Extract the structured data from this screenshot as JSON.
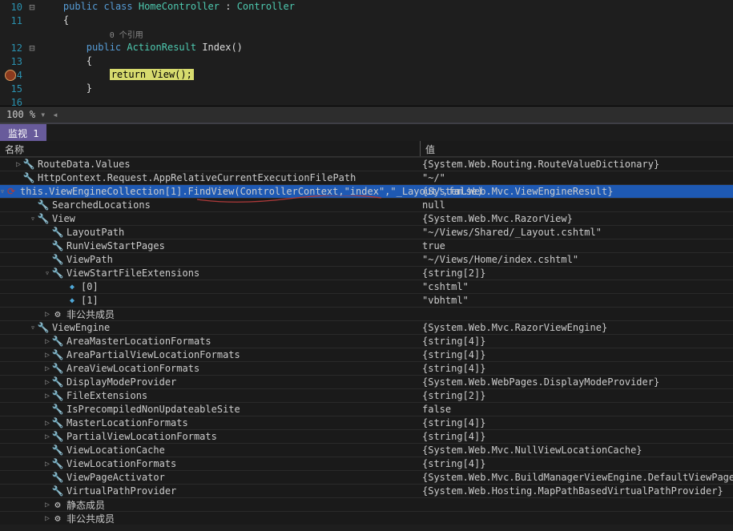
{
  "code": {
    "lines": [
      {
        "num": "10",
        "fold": "⊟",
        "segs": [
          {
            "t": "    ",
            "c": ""
          },
          {
            "t": "public",
            "c": "kw"
          },
          {
            "t": " ",
            "c": ""
          },
          {
            "t": "class",
            "c": "kw"
          },
          {
            "t": " ",
            "c": ""
          },
          {
            "t": "HomeController",
            "c": "type"
          },
          {
            "t": " : ",
            "c": ""
          },
          {
            "t": "Controller",
            "c": "type"
          }
        ]
      },
      {
        "num": "11",
        "fold": "",
        "segs": [
          {
            "t": "    {",
            "c": ""
          }
        ]
      },
      {
        "num": "",
        "fold": "",
        "ref": "0 个引用",
        "indent": "            "
      },
      {
        "num": "12",
        "fold": "⊟",
        "segs": [
          {
            "t": "        ",
            "c": ""
          },
          {
            "t": "public",
            "c": "kw"
          },
          {
            "t": " ",
            "c": ""
          },
          {
            "t": "ActionResult",
            "c": "type"
          },
          {
            "t": " Index()",
            "c": "method"
          }
        ]
      },
      {
        "num": "13",
        "fold": "",
        "segs": [
          {
            "t": "        {",
            "c": ""
          }
        ]
      },
      {
        "num": "14",
        "fold": "",
        "bp": true,
        "segs": [
          {
            "t": "            ",
            "c": ""
          },
          {
            "t": "return View();",
            "c": "highlight-return"
          }
        ]
      },
      {
        "num": "15",
        "fold": "",
        "segs": [
          {
            "t": "        }",
            "c": ""
          }
        ]
      },
      {
        "num": "16",
        "fold": "",
        "segs": [
          {
            "t": "",
            "c": ""
          }
        ]
      }
    ]
  },
  "zoom": "100 %",
  "panel_title": "监视 1",
  "columns": {
    "name": "名称",
    "value": "值"
  },
  "watch": [
    {
      "d": 0,
      "exp": "▷",
      "ico": "wrench",
      "n": "RouteData.Values",
      "v": "{System.Web.Routing.RouteValueDictionary}"
    },
    {
      "d": 0,
      "exp": "",
      "ico": "wrench",
      "n": "HttpContext.Request.AppRelativeCurrentExecutionFilePath",
      "v": "\"~/\""
    },
    {
      "d": 0,
      "exp": "▿",
      "ico": "refresh",
      "n": "this.ViewEngineCollection[1].FindView(ControllerContext,\"index\",\"_Layout\",false)",
      "v": "{System.Web.Mvc.ViewEngineResult}",
      "sel": true
    },
    {
      "d": 1,
      "exp": "",
      "ico": "wrench",
      "n": "SearchedLocations",
      "v": "null"
    },
    {
      "d": 1,
      "exp": "▿",
      "ico": "wrench",
      "n": "View",
      "v": "{System.Web.Mvc.RazorView}"
    },
    {
      "d": 2,
      "exp": "",
      "ico": "wrench",
      "n": "LayoutPath",
      "v": "\"~/Views/Shared/_Layout.cshtml\""
    },
    {
      "d": 2,
      "exp": "",
      "ico": "wrench",
      "n": "RunViewStartPages",
      "v": "true"
    },
    {
      "d": 2,
      "exp": "",
      "ico": "wrench",
      "n": "ViewPath",
      "v": "\"~/Views/Home/index.cshtml\""
    },
    {
      "d": 2,
      "exp": "▿",
      "ico": "wrench",
      "n": "ViewStartFileExtensions",
      "v": "{string[2]}"
    },
    {
      "d": 3,
      "exp": "",
      "ico": "field",
      "n": "[0]",
      "v": "\"cshtml\""
    },
    {
      "d": 3,
      "exp": "",
      "ico": "field",
      "n": "[1]",
      "v": "\"vbhtml\""
    },
    {
      "d": 2,
      "exp": "▷",
      "ico": "gear",
      "n": "非公共成员",
      "v": ""
    },
    {
      "d": 1,
      "exp": "▿",
      "ico": "wrench",
      "n": "ViewEngine",
      "v": "{System.Web.Mvc.RazorViewEngine}"
    },
    {
      "d": 2,
      "exp": "▷",
      "ico": "wrench",
      "n": "AreaMasterLocationFormats",
      "v": "{string[4]}"
    },
    {
      "d": 2,
      "exp": "▷",
      "ico": "wrench",
      "n": "AreaPartialViewLocationFormats",
      "v": "{string[4]}"
    },
    {
      "d": 2,
      "exp": "▷",
      "ico": "wrench",
      "n": "AreaViewLocationFormats",
      "v": "{string[4]}"
    },
    {
      "d": 2,
      "exp": "▷",
      "ico": "wrench",
      "n": "DisplayModeProvider",
      "v": "{System.Web.WebPages.DisplayModeProvider}"
    },
    {
      "d": 2,
      "exp": "▷",
      "ico": "wrench",
      "n": "FileExtensions",
      "v": "{string[2]}"
    },
    {
      "d": 2,
      "exp": "",
      "ico": "wrench",
      "n": "IsPrecompiledNonUpdateableSite",
      "v": "false"
    },
    {
      "d": 2,
      "exp": "▷",
      "ico": "wrench",
      "n": "MasterLocationFormats",
      "v": "{string[4]}"
    },
    {
      "d": 2,
      "exp": "▷",
      "ico": "wrench",
      "n": "PartialViewLocationFormats",
      "v": "{string[4]}"
    },
    {
      "d": 2,
      "exp": "",
      "ico": "wrench",
      "n": "ViewLocationCache",
      "v": "{System.Web.Mvc.NullViewLocationCache}"
    },
    {
      "d": 2,
      "exp": "▷",
      "ico": "wrench",
      "n": "ViewLocationFormats",
      "v": "{string[4]}"
    },
    {
      "d": 2,
      "exp": "",
      "ico": "wrench",
      "n": "ViewPageActivator",
      "v": "{System.Web.Mvc.BuildManagerViewEngine.DefaultViewPageActivator}"
    },
    {
      "d": 2,
      "exp": "",
      "ico": "wrench",
      "n": "VirtualPathProvider",
      "v": "{System.Web.Hosting.MapPathBasedVirtualPathProvider}"
    },
    {
      "d": 2,
      "exp": "▷",
      "ico": "gear",
      "n": "静态成员",
      "v": ""
    },
    {
      "d": 2,
      "exp": "▷",
      "ico": "gear",
      "n": "非公共成员",
      "v": ""
    }
  ]
}
